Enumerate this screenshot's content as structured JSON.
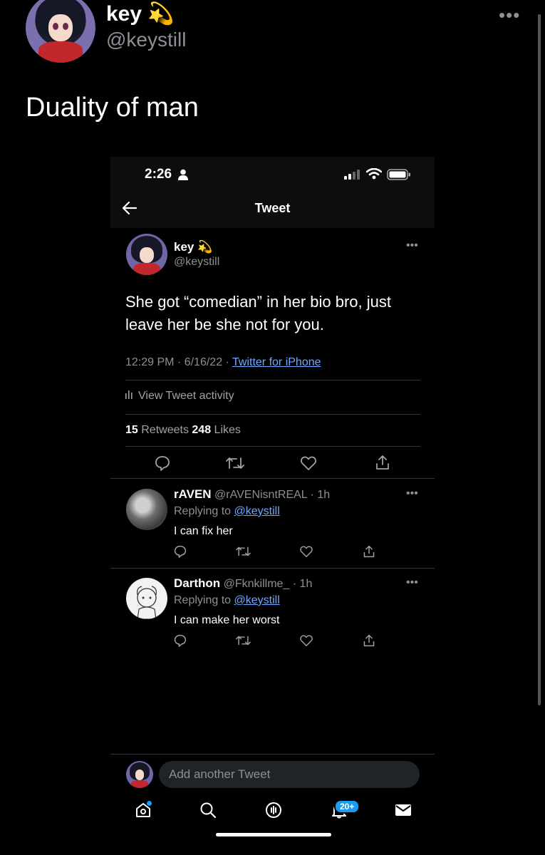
{
  "outer": {
    "name": "key 💫",
    "handle": "@keystill",
    "more": "•••",
    "text": "Duality of man"
  },
  "screenshot": {
    "status_time": "2:26",
    "nav_title": "Tweet",
    "main_tweet": {
      "name": "key 💫",
      "handle": "@keystill",
      "more": "•••",
      "text": "She got “comedian” in her bio bro, just leave her be she not for you.",
      "timestamp": "12:29 PM · 6/16/22 · ",
      "source": "Twitter for iPhone",
      "activity": "View Tweet activity",
      "retweets_count": "15",
      "retweets_label": " Retweets ",
      "likes_count": "248",
      "likes_label": " Likes"
    },
    "replies": [
      {
        "name": "rAVEN",
        "handle": " @rAVENisntREAL · 1h",
        "replying_prefix": "Replying to ",
        "replying_to": "@keystill",
        "text": "I can fix her",
        "more": "•••"
      },
      {
        "name": "Darthon",
        "handle": " @Fknkillme_ · 1h",
        "replying_prefix": "Replying to ",
        "replying_to": "@keystill",
        "text": "I can make her worst",
        "more": "•••"
      }
    ],
    "compose_placeholder": "Add another Tweet",
    "notification_badge": "20+",
    "icons": [
      "person-icon",
      "signal-icon",
      "wifi-icon",
      "battery-icon",
      "back-arrow-icon",
      "reply-icon",
      "retweet-icon",
      "like-icon",
      "share-icon",
      "home-icon",
      "search-icon",
      "spaces-icon",
      "notifications-icon",
      "messages-icon"
    ],
    "colors": {
      "link": "#6fa8ff",
      "accent": "#1d9bf0",
      "background": "#000000"
    }
  }
}
